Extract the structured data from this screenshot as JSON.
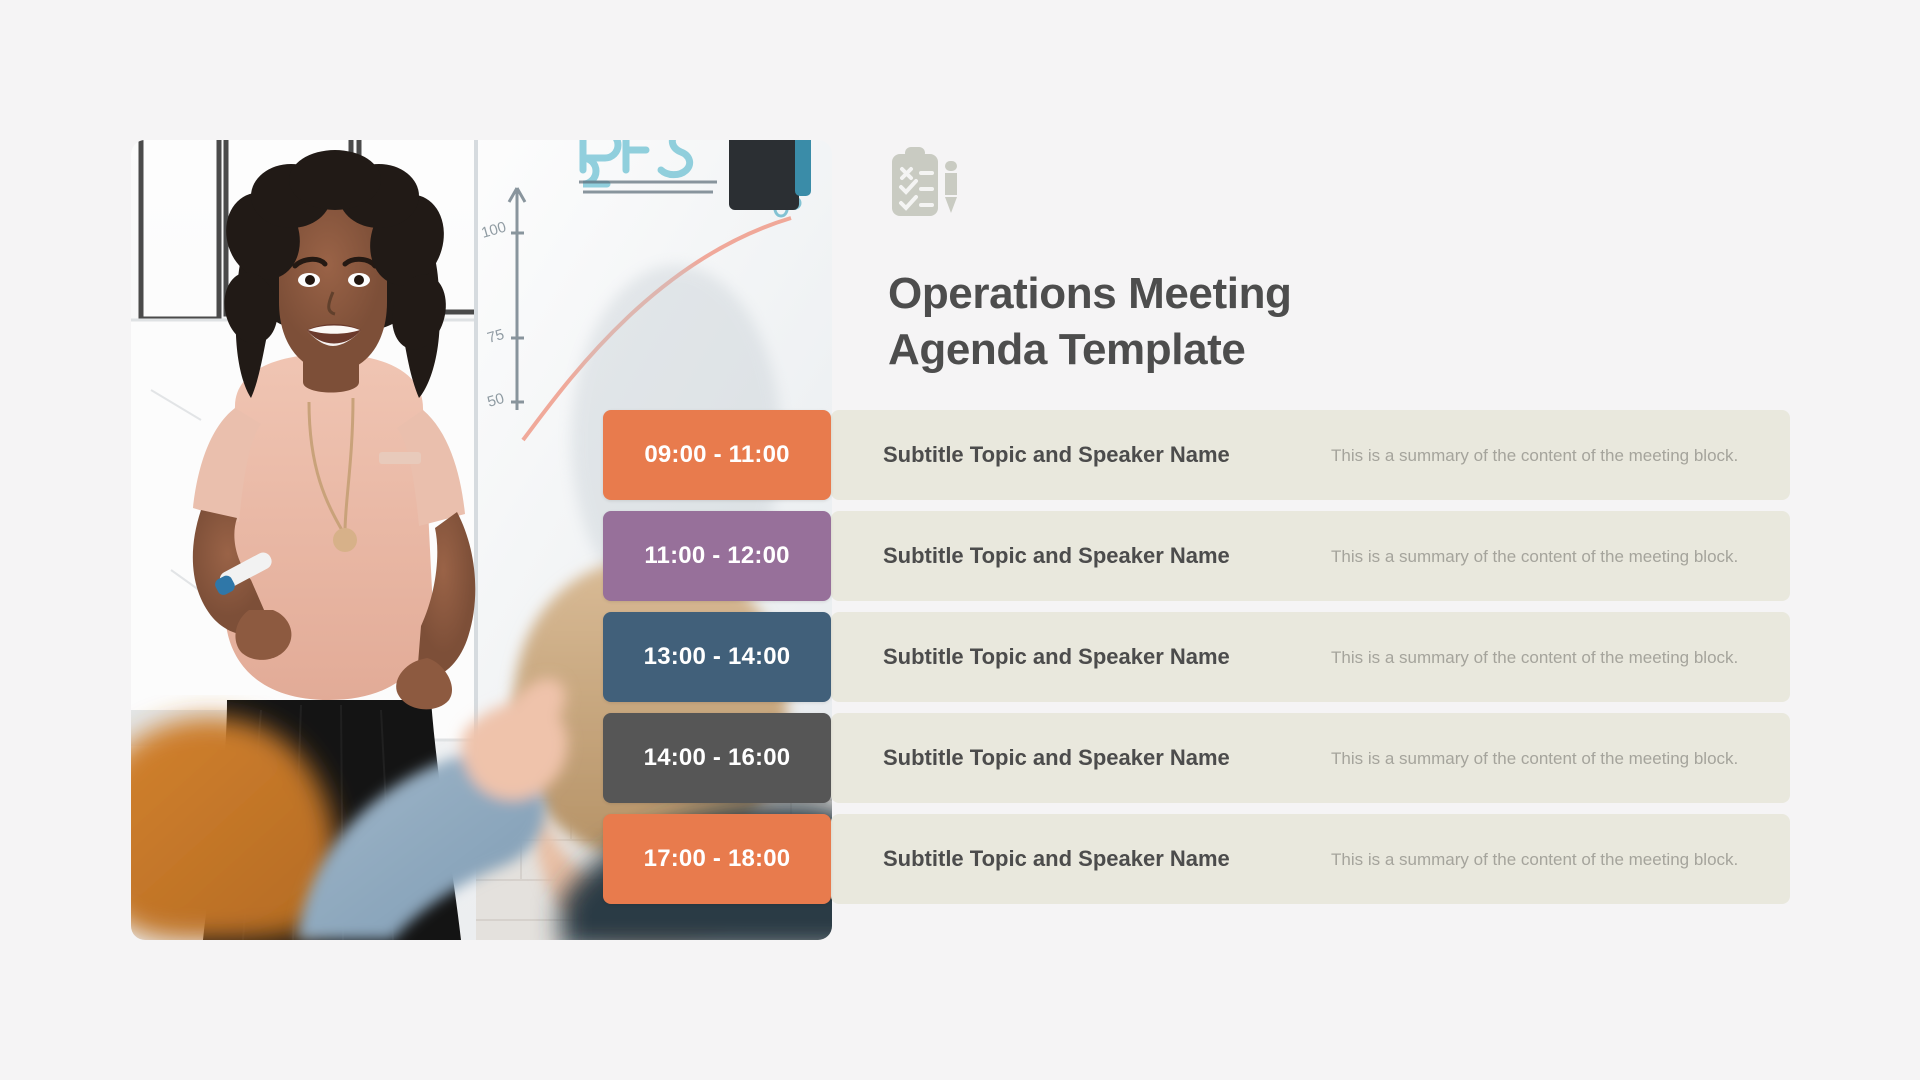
{
  "page": {
    "background_color": "#f5f4f5"
  },
  "header": {
    "icon": "clipboard-checklist-pen-icon",
    "icon_color": "#c9cbc2",
    "title": "Operations Meeting Agenda Template",
    "title_line_1": "Operations Meeting",
    "title_line_2": "Agenda Template",
    "title_color": "#4d4d4d"
  },
  "photo": {
    "name": "meeting-presentation-photo",
    "description": "Woman presenting at a whiteboard to colleagues in a meeting room",
    "whiteboard_text": "BFS",
    "chart_axis_labels": [
      "100",
      "75",
      "50"
    ]
  },
  "agenda": {
    "row_background_color": "#e9e8dd",
    "topic_color": "#4c4c4c",
    "summary_color": "#a5a49c",
    "rows": [
      {
        "time": "09:00 - 11:00",
        "color": "#e87b4d",
        "topic": "Subtitle Topic and Speaker Name",
        "summary": "This is a summary of the content of the meeting block."
      },
      {
        "time": "11:00 - 12:00",
        "color": "#97709a",
        "topic": "Subtitle Topic and Speaker Name",
        "summary": "This is a summary of the content of the meeting block."
      },
      {
        "time": "13:00 - 14:00",
        "color": "#41607a",
        "topic": "Subtitle Topic and Speaker Name",
        "summary": "This is a summary of the content of the meeting block."
      },
      {
        "time": "14:00 - 16:00",
        "color": "#565656",
        "topic": "Subtitle Topic and Speaker Name",
        "summary": "This is a summary of the content of the meeting block."
      },
      {
        "time": "17:00 - 18:00",
        "color": "#e87b4d",
        "topic": "Subtitle Topic and Speaker Name",
        "summary": "This is a summary of the content of the meeting block."
      }
    ]
  }
}
